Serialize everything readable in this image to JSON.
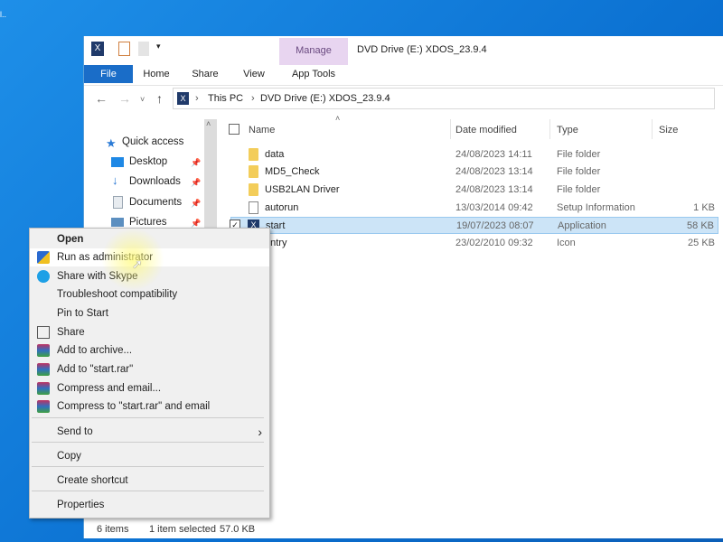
{
  "desktop": {
    "text": "l.."
  },
  "window": {
    "title": "DVD Drive (E:) XDOS_23.9.4",
    "context_tab": "Manage",
    "ribbon_tabs": [
      "File",
      "Home",
      "Share",
      "View",
      "App Tools"
    ],
    "breadcrumb": [
      "This PC",
      "DVD Drive (E:) XDOS_23.9.4"
    ]
  },
  "sidebar": {
    "items": [
      {
        "label": "Quick access",
        "icon": "star-icon",
        "color": "#2b7bd6"
      },
      {
        "label": "Desktop",
        "icon": "desktop-icon",
        "color": "#1e88e5"
      },
      {
        "label": "Downloads",
        "icon": "download-icon",
        "color": "#1e6fd0"
      },
      {
        "label": "Documents",
        "icon": "documents-icon",
        "color": "#9aa6b2"
      },
      {
        "label": "Pictures",
        "icon": "pictures-icon",
        "color": "#5c8fc0"
      }
    ]
  },
  "list": {
    "headers": {
      "name": "Name",
      "date": "Date modified",
      "type": "Type",
      "size": "Size"
    },
    "rows": [
      {
        "name": "data",
        "date": "24/08/2023 14:11",
        "type": "File folder",
        "size": "",
        "icon": "folder"
      },
      {
        "name": "MD5_Check",
        "date": "24/08/2023 13:14",
        "type": "File folder",
        "size": "",
        "icon": "folder"
      },
      {
        "name": "USB2LAN Driver",
        "date": "24/08/2023 13:14",
        "type": "File folder",
        "size": "",
        "icon": "folder"
      },
      {
        "name": "autorun",
        "date": "13/03/2014 09:42",
        "type": "Setup Information",
        "size": "1 KB",
        "icon": "doc"
      },
      {
        "name": "start",
        "date": "19/07/2023 08:07",
        "type": "Application",
        "size": "58 KB",
        "icon": "app",
        "selected": true
      },
      {
        "name": "entry",
        "date": "23/02/2010 09:32",
        "type": "Icon",
        "size": "25 KB",
        "icon": "doc"
      }
    ]
  },
  "status": {
    "count": "6 items",
    "selected": "1 item selected",
    "size": "57.0 KB"
  },
  "context_menu": {
    "items": [
      "Open",
      "Run as administrator",
      "Share with Skype",
      "Troubleshoot compatibility",
      "Pin to Start",
      "Share",
      "Add to archive...",
      "Add to \"start.rar\"",
      "Compress and email...",
      "Compress to \"start.rar\" and email",
      "Send to",
      "Copy",
      "Create shortcut",
      "Properties"
    ],
    "highlighted": "Run as administrator",
    "submenu_arrow": "›"
  }
}
